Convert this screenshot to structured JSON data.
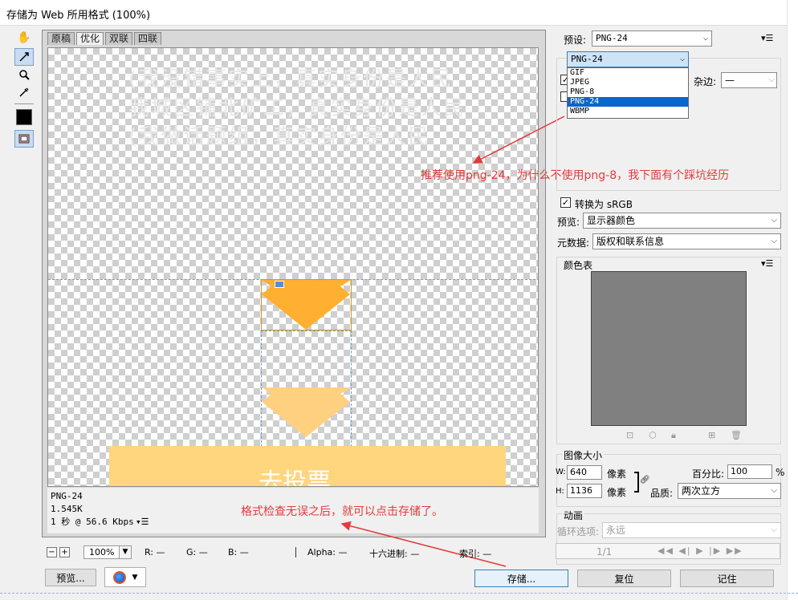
{
  "window": {
    "title": "存储为 Web 所用格式 (100%)"
  },
  "tools": {
    "hand": "hand-icon",
    "slice_select": "slice-select-icon",
    "zoom": "zoom-icon",
    "eyedropper": "eyedropper-icon",
    "swatch": "eyedropper-color-swatch",
    "toggle": "toggle-slices-icon"
  },
  "tabs": [
    "原稿",
    "优化",
    "双联",
    "四联"
  ],
  "canvas": {
    "ghost_lines": [
      "(我没错事实上，真实身份是人民",
      "我城区铺北矿工，真实身份是人民",
      "(我做话题组，真实身份是人民"
    ],
    "button_text": "去投票"
  },
  "image_info": {
    "format": "PNG-24",
    "size": "1.545K",
    "time": "1 秒 @ 56.6 Kbps",
    "menu_glyph": "▾☰"
  },
  "annotations": {
    "recommend": "推荐使用png-24，为什么不使用png-8，我下面有个踩坑经历",
    "save_hint": "格式检查无误之后，就可以点击存储了。"
  },
  "status": {
    "zoom": "100%",
    "minus": "−",
    "plus": "+",
    "r": "R: —",
    "g": "G: —",
    "b": "B: —",
    "alpha": "Alpha: —",
    "hex": "十六进制: —",
    "index": "索引: —"
  },
  "buttons": {
    "preview": "预览...",
    "save": "存储...",
    "reset": "复位",
    "remember": "记住"
  },
  "settings": {
    "preset_label": "预设:",
    "preset_value": "PNG-24",
    "format_value": "PNG-24",
    "format_options": [
      "GIF",
      "JPEG",
      "PNG-8",
      "PNG-24",
      "WBMP"
    ],
    "format_selected_index": 3,
    "transparency_checked": true,
    "interlace_checked": false,
    "matte_label": "杂边:",
    "matte_value": "—",
    "convert_srgb_label": "转换为 sRGB",
    "convert_srgb_checked": true,
    "preview_label": "预览:",
    "preview_value": "显示器颜色",
    "metadata_label": "元数据:",
    "metadata_value": "版权和联系信息"
  },
  "color_table": {
    "title": "颜色表"
  },
  "image_size": {
    "title": "图像大小",
    "w_label": "W:",
    "w_value": "640",
    "w_unit": "像素",
    "h_label": "H:",
    "h_value": "1136",
    "h_unit": "像素",
    "percent_label": "百分比:",
    "percent_value": "100",
    "percent_unit": "%",
    "quality_label": "品质:",
    "quality_value": "两次立方"
  },
  "animation": {
    "title": "动画",
    "loop_label": "循环选项:",
    "loop_value": "永远",
    "frame_counter": "1/1"
  }
}
